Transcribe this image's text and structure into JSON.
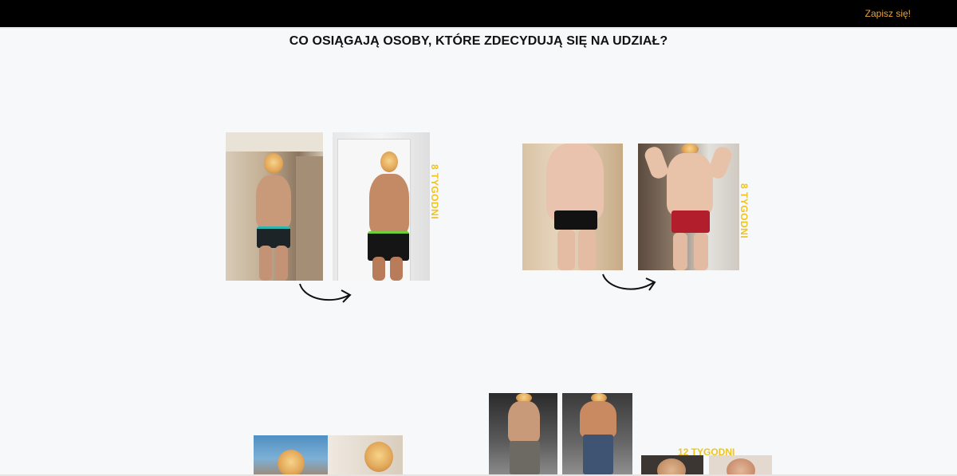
{
  "header": {
    "cta_label": "Zapisz się!",
    "accent": "#e6a43a"
  },
  "section": {
    "title": "CO OSIĄGAJĄ OSOBY, KTÓRE ZDECYDUJĄ SIĘ NA UDZIAŁ?"
  },
  "transformations": [
    {
      "duration": "8 TYGODNI"
    },
    {
      "duration": "8 TYGODNI"
    },
    {
      "duration": "12 TYGODNI"
    }
  ],
  "colors": {
    "duration_label": "#f0c419",
    "background": "#f7f8fa"
  },
  "icons": [
    "arrow-icon"
  ]
}
